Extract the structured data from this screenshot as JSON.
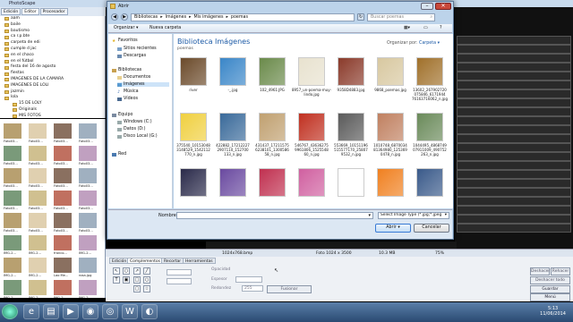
{
  "photoscape": {
    "title": "PhotoScape",
    "tabs": [
      "Edición",
      "Editor",
      "Procesador"
    ],
    "tree": [
      "aam",
      "baile",
      "bautismo",
      "ca r.p.bte",
      "carpeta de edi",
      "cumple d jac",
      "en el chaco",
      "en el fútbol",
      "festa del 16 de agosto",
      "fiestas",
      "IMAGENES DE LA CAMARA",
      "IMAGENES DE LOLI",
      "jazmin",
      "lola",
      "15 DE LOLY",
      "Originals",
      "MIS FOTOS"
    ],
    "thumb_labels": [
      "Foto03...",
      "Foto03...",
      "Foto03...",
      "Foto03...",
      "Foto03...",
      "Foto03...",
      "Foto03...",
      "Foto03...",
      "Foto03...",
      "Foto03...",
      "Foto03...",
      "Foto03...",
      "Foto03...",
      "Foto03...",
      "Foto03...",
      "Foto03...",
      "Foto03...",
      "Foto03...",
      "Foto03...",
      "Foto03...",
      "IMG-2...",
      "IMG-2...",
      "franco...",
      "IMG-2...",
      "IMG-2...",
      "IMG-2...",
      "Lao Me...",
      "rosa.jpg",
      "IMG-2...",
      "IMG-2...",
      "IMG-2...",
      "IMG-2..."
    ],
    "status": {
      "size": "1024x768.bmp",
      "photo": "Foto 1024 x 3500",
      "filesize": "10.3 MB",
      "zoom": "75%"
    },
    "bottom_tabs": [
      "Edición",
      "Complementos",
      "Recortar",
      "Herramientas"
    ],
    "bottom_labels": {
      "opacity": "Opacidad",
      "width": "Espesor",
      "radius": "Redondez",
      "merge": "Fusionar",
      "radius_value": "255"
    },
    "right_buttons": {
      "undo": "Deshacer",
      "redo": "Rehacer",
      "undo_all": "Deshacer todo",
      "save": "Guardar",
      "menu": "Menú"
    }
  },
  "dialog": {
    "title": "Abrir",
    "breadcrumb": [
      "Bibliotecas",
      "Imágenes",
      "Mis imágenes",
      "poemas"
    ],
    "search_placeholder": "Buscar poemas",
    "commands": {
      "organize": "Organizar ▾",
      "new_folder": "Nueva carpeta"
    },
    "nav": {
      "favorites": "Favoritos",
      "recent": "Sitios recientes",
      "downloads": "Descargas",
      "libraries": "Bibliotecas",
      "documents": "Documentos",
      "images": "Imágenes",
      "music": "Música",
      "videos": "Vídeos",
      "computer": "Equipo",
      "drive_c": "Windows (C:)",
      "drive_d": "Datos (D:)",
      "drive_local": "Disco Local (G:)",
      "network": "Red"
    },
    "library_title": "Biblioteca Imágenes",
    "library_sub": "poemas",
    "arrange_label": "Organizar por:",
    "arrange_value": "Carpeta ▾",
    "files": [
      {
        "name": "river",
        "color": "#6b4a2a"
      },
      {
        "name": "-_.jpg",
        "color": "#3a86c8"
      },
      {
        "name": "102_4961.JPG",
        "color": "#6a8a4a"
      },
      {
        "name": "8957_un-poema-muy-lindo.jpg",
        "color": "#e8e2cf"
      },
      {
        "name": "9358D4883.jpg",
        "color": "#8a3a2a"
      },
      {
        "name": "9868_poemas.jpg",
        "color": "#d8c8a0"
      },
      {
        "name": "13602_267902720 075846_6171944 76163716062_n.jpg",
        "color": "#a0702a"
      },
      {
        "name": "375540_10153048 3148529_1542112 770_n.jpg",
        "color": "#f0d040"
      },
      {
        "name": "422882_17212227 2907110_152700 133_n.jpg",
        "color": "#3a6a9a"
      },
      {
        "name": "431437_17211575 6238101_1300586 58_n.jpg",
        "color": "#c0a070"
      },
      {
        "name": "546767_43636275 9961806_1525548 60_n.jpg",
        "color": "#c03020"
      },
      {
        "name": "553669_10151196 515577170_25807 9532_n.jpg",
        "color": "#5a5a5a"
      },
      {
        "name": "1010748_6870034 81364980_125369 0478_n.jpg",
        "color": "#c08060"
      },
      {
        "name": "1044495_4868749 07911009_490752 263_n.jpg",
        "color": "#6a8a5a"
      },
      {
        "name": "",
        "color": "#2a2a4a"
      },
      {
        "name": "",
        "color": "#6a4aa0"
      },
      {
        "name": "",
        "color": "#c03050"
      },
      {
        "name": "",
        "color": "#d060a0"
      },
      {
        "name": "",
        "color": "#222"
      },
      {
        "name": "",
        "color": "#f08020"
      },
      {
        "name": "",
        "color": "#3a5a8a"
      }
    ],
    "filename_label": "Nombre:",
    "filetype_value": "Select Image Type (*.jpg;*.jpeg",
    "open_label": "Abrir",
    "cancel_label": "Cancelar"
  },
  "taskbar": {
    "time": "5:13",
    "date": "11/06/2014"
  },
  "colors": {
    "dialog_bg": "#bcd3ea",
    "title_text": "#1c5aa6",
    "accent": "#3a7bd5"
  }
}
